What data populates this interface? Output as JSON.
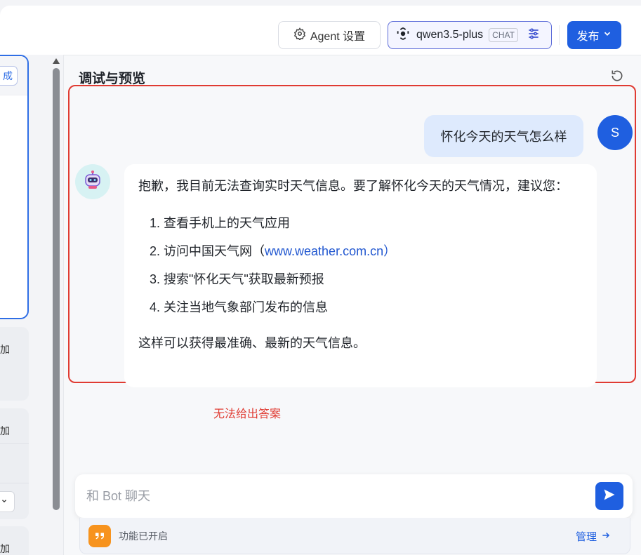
{
  "header": {
    "agent_settings_label": "Agent 设置",
    "model_name": "qwen3.5-plus",
    "model_badge": "CHAT",
    "publish_label": "发布"
  },
  "left_panel": {
    "card_button_label": "成",
    "card_labels": [
      "加",
      "加",
      "加"
    ]
  },
  "debug_panel": {
    "title": "调试与预览",
    "user_message": "怀化今天的天气怎么样",
    "user_avatar_initial": "S",
    "bot_reply": {
      "intro": "抱歉，我目前无法查询实时天气信息。要了解怀化今天的天气情况，建议您：",
      "items": [
        {
          "num": "1. ",
          "text": "查看手机上的天气应用"
        },
        {
          "num": "2. ",
          "text": "访问中国天气网（",
          "link": "www.weather.com.cn",
          "suffix": "）"
        },
        {
          "num": "3. ",
          "text": "搜索\"怀化天气\"获取最新预报"
        },
        {
          "num": "4. ",
          "text": "关注当地气象部门发布的信息"
        }
      ],
      "outro": "这样可以获得最准确、最新的天气信息。"
    },
    "annotation": "无法给出答案",
    "input_placeholder": "和 Bot 聊天",
    "feature_status": "功能已开启",
    "manage_label": "管理"
  },
  "colors": {
    "primary": "#1f5fe0",
    "annotation_red": "#e03b32",
    "user_bubble": "#deeafd",
    "feature_icon": "#f7931e"
  }
}
